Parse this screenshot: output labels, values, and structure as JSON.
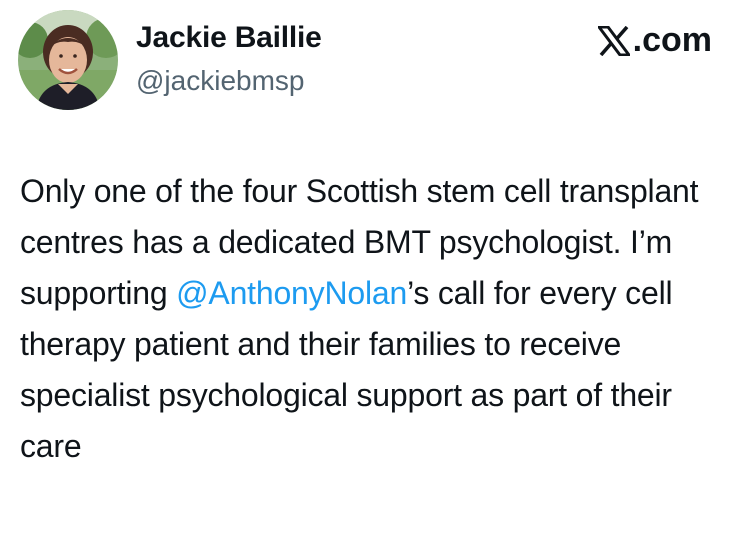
{
  "author": {
    "display_name": "Jackie Baillie",
    "handle": "@jackiebmsp",
    "avatar_icon": "profile-photo"
  },
  "brand": {
    "icon": "x-logo-icon",
    "label": ".com"
  },
  "tweet": {
    "text_before_mention": "Only one of the four Scottish stem cell transplant centres has a dedicated BMT psychologist. I’m supporting ",
    "mention": "@AnthonyNolan",
    "text_after_mention": "’s call for every cell therapy patient and their families to receive specialist psychological support as part of their care"
  },
  "colors": {
    "text": "#0f1419",
    "secondary_text": "#536471",
    "link": "#1d9bf0",
    "background": "#ffffff"
  }
}
